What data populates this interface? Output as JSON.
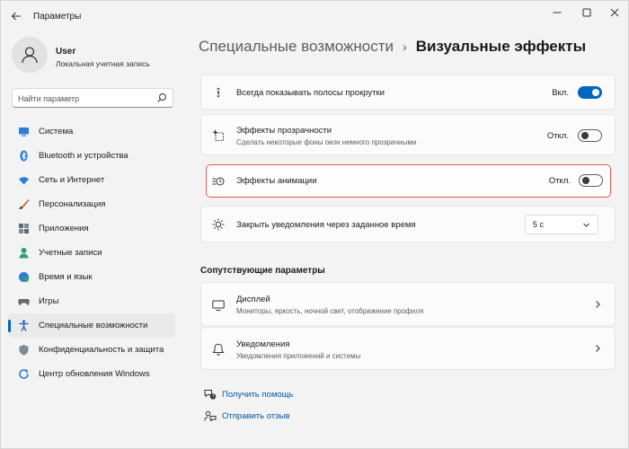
{
  "window": {
    "title": "Параметры",
    "controls": [
      "minimize-icon",
      "maximize-icon",
      "close-icon"
    ]
  },
  "user": {
    "name": "User",
    "account_type": "Локальная учетная запись"
  },
  "search": {
    "placeholder": "Найти параметр",
    "value": ""
  },
  "sidebar": {
    "items": [
      {
        "label": "Система",
        "icon": "monitor-icon",
        "active": false
      },
      {
        "label": "Bluetooth и устройства",
        "icon": "bluetooth-icon",
        "active": false
      },
      {
        "label": "Сеть и Интернет",
        "icon": "wifi-icon",
        "active": false
      },
      {
        "label": "Персонализация",
        "icon": "brush-icon",
        "active": false
      },
      {
        "label": "Приложения",
        "icon": "apps-icon",
        "active": false
      },
      {
        "label": "Учетные записи",
        "icon": "person-icon",
        "active": false
      },
      {
        "label": "Время и язык",
        "icon": "globe-clock-icon",
        "active": false
      },
      {
        "label": "Игры",
        "icon": "gamepad-icon",
        "active": false
      },
      {
        "label": "Специальные возможности",
        "icon": "accessibility-icon",
        "active": true
      },
      {
        "label": "Конфиденциальность и защита",
        "icon": "shield-icon",
        "active": false
      },
      {
        "label": "Центр обновления Windows",
        "icon": "update-icon",
        "active": false
      }
    ]
  },
  "breadcrumb": {
    "parent": "Специальные возможности",
    "separator": "›",
    "current": "Визуальные эффекты"
  },
  "settings": {
    "scrollbars": {
      "title": "Всегда показывать полосы прокрутки",
      "state_label": "Вкл.",
      "on": true
    },
    "transparency": {
      "title": "Эффекты прозрачности",
      "description": "Сделать некоторые фоны окон немного прозрачными",
      "state_label": "Откл.",
      "on": false
    },
    "animation": {
      "title": "Эффекты анимации",
      "state_label": "Откл.",
      "on": false
    },
    "notifications_timeout": {
      "title": "Закрыть уведомления через заданное время",
      "selected": "5 с"
    }
  },
  "related": {
    "title": "Сопутствующие параметры",
    "items": [
      {
        "title": "Дисплей",
        "description": "Мониторы, яркость, ночной свет, отображение профиля",
        "icon": "display-icon"
      },
      {
        "title": "Уведомления",
        "description": "Уведомления приложений и системы",
        "icon": "bell-icon"
      }
    ]
  },
  "links": {
    "help": "Получить помощь",
    "feedback": "Отправить отзыв"
  },
  "colors": {
    "accent": "#0067c0",
    "highlight_border": "#e05a5a",
    "window_bg": "#f3f3f3",
    "card_bg": "#fbfbfb"
  }
}
